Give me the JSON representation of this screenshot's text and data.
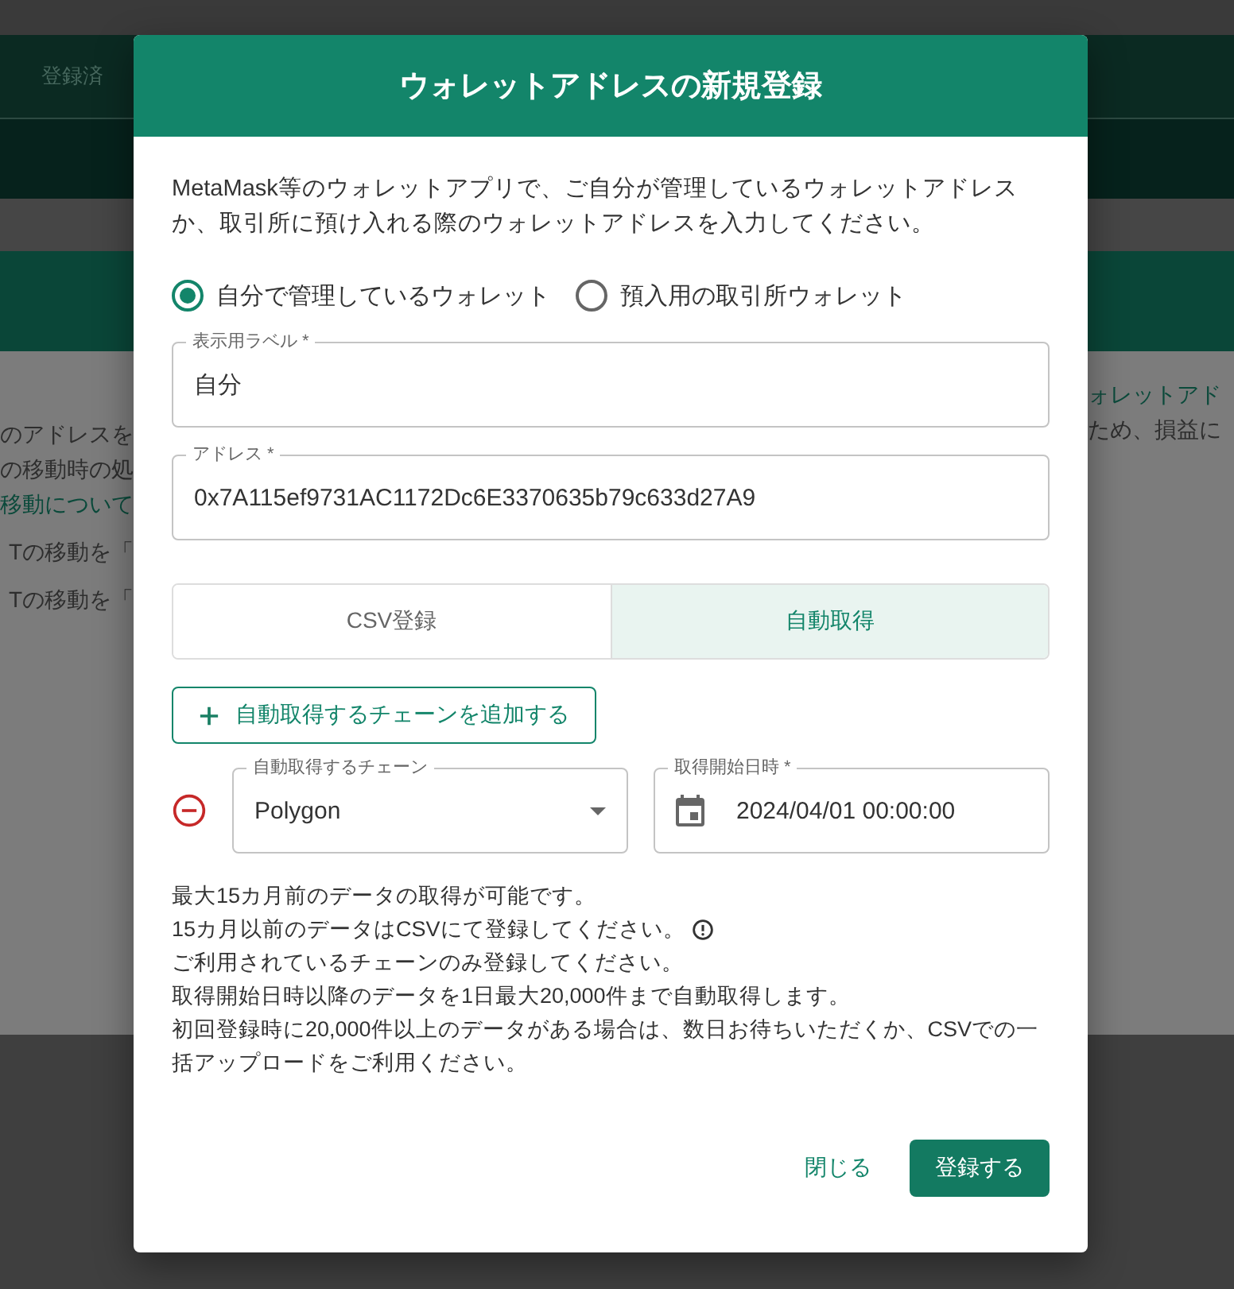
{
  "background": {
    "tab": "登録済",
    "left_lines": [
      {
        "kind": "text",
        "text": "のアドレスを"
      },
      {
        "kind": "text",
        "text": "の移動時の処"
      },
      {
        "kind": "link",
        "text": "移動について"
      },
      {
        "kind": "spaced",
        "text": "Tの移動を「"
      },
      {
        "kind": "spaced",
        "text": "Tの移動を「"
      }
    ],
    "right_lines": [
      {
        "kind": "link",
        "text": "ォレットアド"
      },
      {
        "kind": "text",
        "text": "ため、損益に"
      }
    ]
  },
  "dialog": {
    "title": "ウォレットアドレスの新規登録",
    "intro": "MetaMask等のウォレットアプリで、ご自分が管理しているウォレットアドレスか、取引所に預け入れる際のウォレットアドレスを入力してください。",
    "wallet_types": [
      {
        "label": "自分で管理しているウォレット",
        "selected": true
      },
      {
        "label": "預入用の取引所ウォレット",
        "selected": false
      }
    ],
    "fields": [
      {
        "label": "表示用ラベル *",
        "value": "自分"
      },
      {
        "label": "アドレス *",
        "value": "0x7A115ef9731AC1172Dc6E3370635b79c633d27A9"
      }
    ],
    "modes": [
      {
        "label": "CSV登録",
        "selected": false
      },
      {
        "label": "自動取得",
        "selected": true
      }
    ],
    "add_chain_button": "自動取得するチェーンを追加する",
    "chains": [
      {
        "chain_label": "自動取得するチェーン",
        "chain": "Polygon",
        "date_label": "取得開始日時 *",
        "date": "2024/04/01 00:00:00"
      }
    ],
    "notes": [
      {
        "text": "最大15カ月前のデータの取得が可能です。",
        "info": false
      },
      {
        "text": "15カ月以前のデータはCSVにて登録してください。",
        "info": true
      },
      {
        "text": "ご利用されているチェーンのみ登録してください。",
        "info": false
      },
      {
        "text": "取得開始日時以降のデータを1日最大20,000件まで自動取得します。",
        "info": false
      },
      {
        "text": "初回登録時に20,000件以上のデータがある場合は、数日お待ちいただくか、CSVでの一括アップロードをご利用ください。",
        "info": false
      }
    ],
    "buttons": [
      {
        "kind": "text",
        "label": "閉じる"
      },
      {
        "kind": "primary",
        "label": "登録する"
      }
    ]
  }
}
